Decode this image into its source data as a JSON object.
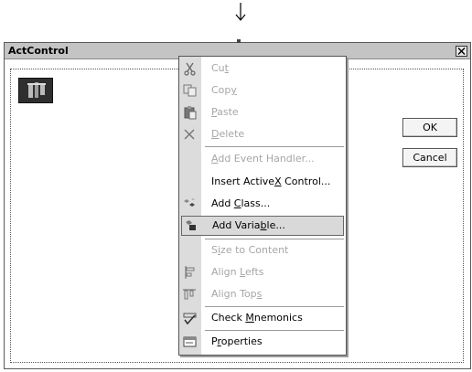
{
  "window": {
    "title": "ActControl",
    "close_glyph": "×"
  },
  "buttons": {
    "ok_label": "OK",
    "cancel_label": "Cancel"
  },
  "context_menu": {
    "items": [
      {
        "pre": "Cu",
        "key": "t",
        "post": "",
        "enabled": false,
        "icon": "scissors-icon"
      },
      {
        "pre": "Cop",
        "key": "y",
        "post": "",
        "enabled": false,
        "icon": "copy-icon"
      },
      {
        "pre": "",
        "key": "P",
        "post": "aste",
        "enabled": false,
        "icon": "paste-icon"
      },
      {
        "pre": "",
        "key": "D",
        "post": "elete",
        "enabled": false,
        "icon": "delete-icon"
      },
      {
        "pre": "",
        "key": "A",
        "post": "dd Event Handler...",
        "enabled": false,
        "icon": ""
      },
      {
        "pre": "Insert Active",
        "key": "X",
        "post": " Control...",
        "enabled": true,
        "icon": ""
      },
      {
        "pre": "Add ",
        "key": "C",
        "post": "lass...",
        "enabled": true,
        "icon": "add-class-icon"
      },
      {
        "pre": "Add Varia",
        "key": "b",
        "post": "le...",
        "enabled": true,
        "icon": "add-variable-icon",
        "highlighted": true
      },
      {
        "pre": "S",
        "key": "i",
        "post": "ze to Content",
        "enabled": false,
        "icon": ""
      },
      {
        "pre": "Align ",
        "key": "L",
        "post": "efts",
        "enabled": false,
        "icon": "align-lefts-icon"
      },
      {
        "pre": "Align Top",
        "key": "s",
        "post": "",
        "enabled": false,
        "icon": "align-tops-icon"
      },
      {
        "pre": "Check ",
        "key": "M",
        "post": "nemonics",
        "enabled": true,
        "icon": "check-mnemonics-icon"
      },
      {
        "pre": "P",
        "key": "r",
        "post": "operties",
        "enabled": true,
        "icon": "properties-icon"
      }
    ]
  },
  "colors": {
    "menu_icon_strip": "#dcdcdc",
    "highlight": "#d9d9d9",
    "disabled_text": "#a6a6a6",
    "titlebar": "#c4c4c4"
  }
}
